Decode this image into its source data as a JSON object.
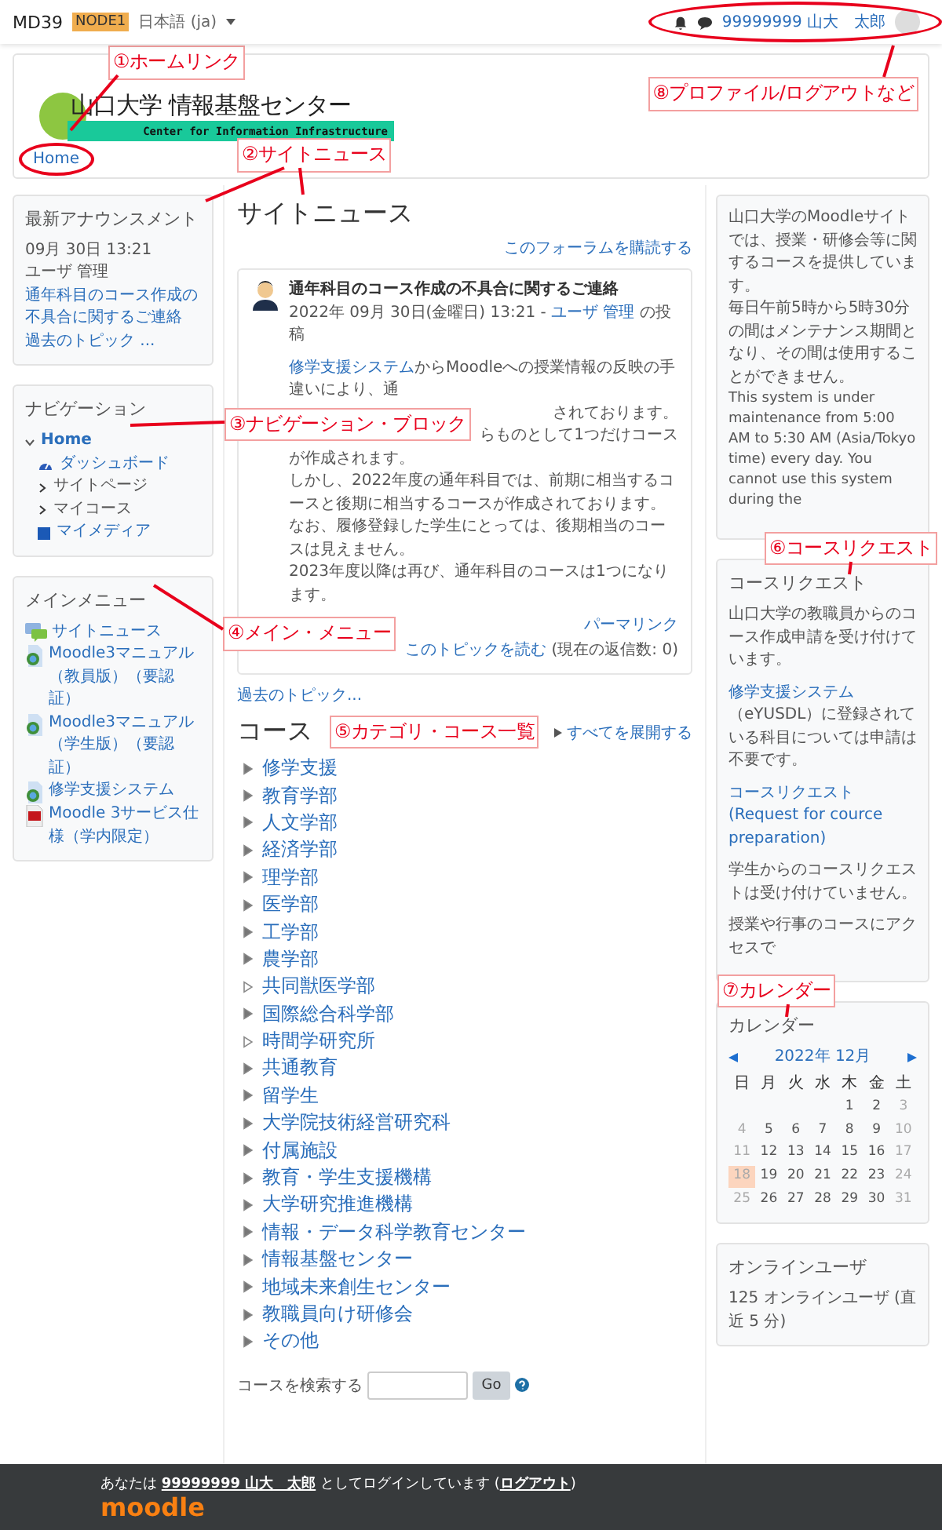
{
  "topbar": {
    "site": "MD39",
    "node_badge": "NODE1",
    "language": "日本語 (ja)",
    "user_name": "99999999 山大　太郎"
  },
  "header": {
    "logo_title": "山口大学 情報基盤センター",
    "logo_subtitle": "Center for Information Infrastructure",
    "breadcrumb": "Home"
  },
  "announcements": {
    "title": "最新アナウンスメント",
    "date": "09月 30日 13:21",
    "author": "ユーザ 管理",
    "link": "通年科目のコース作成の不具合に関するご連絡",
    "more": "過去のトピック ..."
  },
  "navigation": {
    "title": "ナビゲーション",
    "items": [
      {
        "label": "Home",
        "kind": "branch",
        "expanded": true,
        "children": [
          {
            "label": "ダッシュボード",
            "kind": "dashboard"
          },
          {
            "label": "サイトページ",
            "kind": "branch",
            "expanded": false
          },
          {
            "label": "マイコース",
            "kind": "branch",
            "expanded": false
          },
          {
            "label": "マイメディア",
            "kind": "media"
          }
        ]
      }
    ]
  },
  "main_menu": {
    "title": "メインメニュー",
    "items": [
      {
        "label": "サイトニュース",
        "kind": "forum"
      },
      {
        "label": "Moodle3マニュアル（教員版）（要認証）",
        "kind": "url"
      },
      {
        "label": "Moodle3マニュアル（学生版）（要認証）",
        "kind": "url"
      },
      {
        "label": "修学支援システム",
        "kind": "url"
      },
      {
        "label": "Moodle 3サービス仕様（学内限定）",
        "kind": "pdf"
      }
    ]
  },
  "site_news": {
    "title": "サイトニュース",
    "subscribe": "このフォーラムを購読する",
    "post": {
      "title": "通年科目のコース作成の不具合に関するご連絡",
      "date": "2022年 09月 30日(金曜日) 13:21 - ",
      "author": "ユーザ 管理",
      "posted": " の投稿",
      "body_link": "修学支援システム",
      "first_line": "からMoodleへの授業情報の反映の手違いにより、通",
      "cut_lines": [
        "されております。",
        "らものとして1つだけコース"
      ],
      "lines": [
        "が作成されます。",
        "しかし、2022年度の通年科目では、前期に相当するコースと後期に相当するコースが作成されております。",
        "なお、履修登録した学生にとっては、後期相当のコースは見えません。",
        "2023年度以降は再び、通年科目のコースは1つになります。"
      ],
      "permalink": "パーマリンク",
      "read": "このトピックを読む",
      "replies": "(現在の返信数: 0)"
    },
    "older": "過去のトピック..."
  },
  "courses": {
    "title": "コース",
    "expand_all": "すべてを展開する",
    "items": [
      {
        "label": "修学支援",
        "empty": false
      },
      {
        "label": "教育学部",
        "empty": false
      },
      {
        "label": "人文学部",
        "empty": false
      },
      {
        "label": "経済学部",
        "empty": false
      },
      {
        "label": "理学部",
        "empty": false
      },
      {
        "label": "医学部",
        "empty": false
      },
      {
        "label": "工学部",
        "empty": false
      },
      {
        "label": "農学部",
        "empty": false
      },
      {
        "label": "共同獣医学部",
        "empty": true
      },
      {
        "label": "国際総合科学部",
        "empty": false
      },
      {
        "label": "時間学研究所",
        "empty": true
      },
      {
        "label": "共通教育",
        "empty": false
      },
      {
        "label": "留学生",
        "empty": false
      },
      {
        "label": "大学院技術経営研究科",
        "empty": false
      },
      {
        "label": "付属施設",
        "empty": false
      },
      {
        "label": "教育・学生支援機構",
        "empty": false
      },
      {
        "label": "大学研究推進機構",
        "empty": false
      },
      {
        "label": "情報・データ科学教育センター",
        "empty": false
      },
      {
        "label": "情報基盤センター",
        "empty": false
      },
      {
        "label": "地域未来創生センター",
        "empty": false
      },
      {
        "label": "教職員向け研修会",
        "empty": false
      },
      {
        "label": "その他",
        "empty": false
      }
    ],
    "search_label": "コースを検索する",
    "search_button": "Go"
  },
  "notice": {
    "paragraphs": [
      "山口大学のMoodleサイトでは、授業・研修会等に関するコースを提供しています。",
      "毎日午前5時から5時30分の間はメンテナンス期間となり、その間は使用することができません。",
      "This system is under maintenance from 5:00 AM to 5:30 AM (Asia/Tokyo time) every day. You cannot use this system during the"
    ]
  },
  "course_request": {
    "title": "コースリクエスト",
    "paragraphs": [
      {
        "text": "山口大学の教職員からのコース作成申請を受け付けています。"
      },
      {
        "link": "修学支援システム",
        "text": "（eYUSDL）に登録されている科目については申請は不要です。"
      },
      {
        "link": "コースリクエスト (Request for cource preparation)"
      },
      {
        "text": "学生からのコースリクエストは受け付けていません。"
      },
      {
        "text": "授業や行事のコースにアクセスで"
      }
    ]
  },
  "calendar": {
    "title": "カレンダー",
    "month": "2022年 12月",
    "weekdays": [
      "日",
      "月",
      "火",
      "水",
      "木",
      "金",
      "土"
    ],
    "weeks": [
      [
        {
          "day": "1",
          "today": false
        },
        {
          "day": "2",
          "today": false
        },
        {
          "day": "3",
          "today": false
        }
      ],
      [
        {
          "day": "4",
          "today": false
        },
        {
          "day": "5",
          "today": false
        },
        {
          "day": "6",
          "today": false
        },
        {
          "day": "7",
          "today": false
        },
        {
          "day": "8",
          "today": false
        },
        {
          "day": "9",
          "today": false
        },
        {
          "day": "10",
          "today": false
        }
      ],
      [
        {
          "day": "11",
          "today": false
        },
        {
          "day": "12",
          "today": false
        },
        {
          "day": "13",
          "today": false
        },
        {
          "day": "14",
          "today": false
        },
        {
          "day": "15",
          "today": false
        },
        {
          "day": "16",
          "today": false
        },
        {
          "day": "17",
          "today": false
        }
      ],
      [
        {
          "day": "18",
          "today": true
        },
        {
          "day": "19",
          "today": false
        },
        {
          "day": "20",
          "today": false
        },
        {
          "day": "21",
          "today": false
        },
        {
          "day": "22",
          "today": false
        },
        {
          "day": "23",
          "today": false
        },
        {
          "day": "24",
          "today": false
        }
      ],
      [
        {
          "day": "25",
          "today": false
        },
        {
          "day": "26",
          "today": false
        },
        {
          "day": "27",
          "today": false
        },
        {
          "day": "28",
          "today": false
        },
        {
          "day": "29",
          "today": false
        },
        {
          "day": "30",
          "today": false
        },
        {
          "day": "31",
          "today": false
        }
      ]
    ]
  },
  "online_users": {
    "title": "オンラインユーザ",
    "text": "125 オンラインユーザ (直近 5 分)"
  },
  "footer": {
    "before": "あなたは ",
    "user": "99999999 山大　太郎",
    "middle": " としてログインしています (",
    "logout": "ログアウト",
    "after": ")",
    "logo": "moodle"
  },
  "annotations": [
    "①ホームリンク",
    "⑧プロファイル/ログアウトなど",
    "②サイトニュース",
    "③ナビゲーション・ブロック",
    "④メイン・メニュー",
    "⑤カテゴリ・コース一覧",
    "⑥コースリクエスト",
    "⑦カレンダー"
  ]
}
